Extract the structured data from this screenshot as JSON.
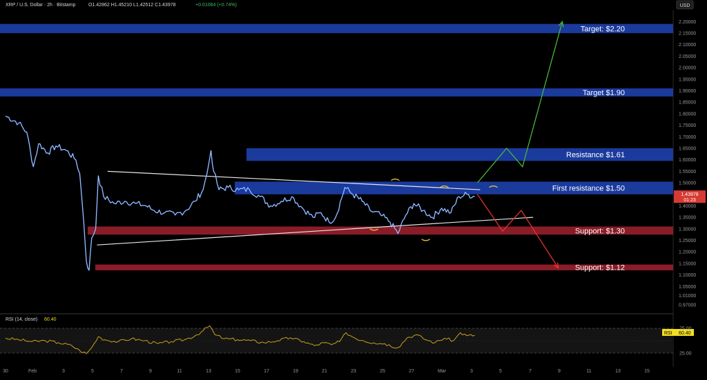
{
  "header": {
    "title": "XRP / U.S. Dollar · 2h · Bitstamp",
    "ohlc_text": "O1.42862 H1.45210 L1.42512 C1.43978",
    "change_text": "+0.01064 (+0.74%)",
    "currency_button": "USD"
  },
  "colors": {
    "background": "#000000",
    "price_line": "#6fa3ff",
    "resistance_zone": "#1a3a9c",
    "support_zone": "#8a1c28",
    "trendline": "#e8e8e8",
    "bull_arrow": "#49b83a",
    "bear_arrow": "#e3332f",
    "rsi_line": "#c8a21e",
    "price_badge": "#d63a32",
    "rsi_badge": "#f2dd22"
  },
  "price_badge": {
    "price": "1.43978",
    "countdown": "01:23"
  },
  "rsi": {
    "title": "RSI (14, close)",
    "value": "60.40",
    "badge_label": "RSI",
    "badge_value": "60.40",
    "upper": 75,
    "lower": 25,
    "upper_label": "75.00",
    "lower_label": "25.00"
  },
  "chart_data": {
    "type": "line",
    "title": "",
    "xlabel": "",
    "ylabel": "",
    "ylim": [
      0.94,
      2.24
    ],
    "y_ticks": [
      "2.20000",
      "2.15000",
      "2.10000",
      "2.05000",
      "2.00000",
      "1.95000",
      "1.90000",
      "1.85000",
      "1.80000",
      "1.75000",
      "1.70000",
      "1.65000",
      "1.60000",
      "1.55000",
      "1.50000",
      "1.45000",
      "1.40000",
      "1.35000",
      "1.30000",
      "1.25000",
      "1.20000",
      "1.15000",
      "1.10000",
      "1.05000",
      "1.01000",
      "0.97000"
    ],
    "x_ticks": [
      "30",
      "Feb",
      "3",
      "5",
      "7",
      "9",
      "11",
      "13",
      "15",
      "17",
      "19",
      "21",
      "23",
      "25",
      "27",
      "Mar",
      "3",
      "5",
      "7",
      "9",
      "11",
      "13",
      "15"
    ],
    "zones": [
      {
        "name": "Target: $2.20",
        "kind": "resistance",
        "low": 2.15,
        "high": 2.19
      },
      {
        "name": "Target $1.90",
        "kind": "resistance",
        "low": 1.875,
        "high": 1.91
      },
      {
        "name": "Resistance $1.61",
        "kind": "resistance",
        "low": 1.595,
        "high": 1.65
      },
      {
        "name": "First resistance $1.50",
        "kind": "resistance",
        "low": 1.45,
        "high": 1.505
      },
      {
        "name": "Support: $1.30",
        "kind": "support",
        "low": 1.275,
        "high": 1.31
      },
      {
        "name": "Support: $1.12",
        "kind": "support",
        "low": 1.12,
        "high": 1.145
      }
    ],
    "series": [
      {
        "values": [
          [
            0.0,
            1.79
          ],
          [
            1.0,
            1.76
          ],
          [
            1.6,
            1.72
          ],
          [
            2.1,
            1.57
          ],
          [
            2.5,
            1.67
          ],
          [
            3.2,
            1.63
          ],
          [
            3.8,
            1.66
          ],
          [
            4.6,
            1.64
          ],
          [
            5.3,
            1.6
          ],
          [
            5.6,
            1.54
          ],
          [
            5.9,
            1.33
          ],
          [
            6.1,
            1.16
          ],
          [
            6.3,
            1.12
          ],
          [
            6.5,
            1.26
          ],
          [
            6.8,
            1.3
          ],
          [
            7.0,
            1.53
          ],
          [
            7.4,
            1.44
          ],
          [
            8.2,
            1.41
          ],
          [
            9.0,
            1.42
          ],
          [
            9.8,
            1.41
          ],
          [
            10.6,
            1.4
          ],
          [
            11.2,
            1.38
          ],
          [
            12.0,
            1.37
          ],
          [
            12.8,
            1.36
          ],
          [
            13.6,
            1.38
          ],
          [
            14.3,
            1.42
          ],
          [
            14.9,
            1.47
          ],
          [
            15.2,
            1.54
          ],
          [
            15.5,
            1.64
          ],
          [
            15.7,
            1.55
          ],
          [
            16.1,
            1.47
          ],
          [
            16.8,
            1.48
          ],
          [
            17.6,
            1.47
          ],
          [
            18.4,
            1.47
          ],
          [
            19.2,
            1.44
          ],
          [
            20.0,
            1.4
          ],
          [
            20.8,
            1.42
          ],
          [
            21.6,
            1.44
          ],
          [
            22.4,
            1.39
          ],
          [
            23.2,
            1.35
          ],
          [
            23.8,
            1.37
          ],
          [
            24.4,
            1.33
          ],
          [
            24.9,
            1.35
          ],
          [
            25.6,
            1.48
          ],
          [
            26.2,
            1.45
          ],
          [
            26.9,
            1.42
          ],
          [
            27.5,
            1.38
          ],
          [
            28.3,
            1.36
          ],
          [
            29.0,
            1.33
          ],
          [
            29.6,
            1.28
          ],
          [
            30.2,
            1.36
          ],
          [
            30.8,
            1.41
          ],
          [
            31.5,
            1.38
          ],
          [
            32.2,
            1.35
          ],
          [
            32.9,
            1.39
          ],
          [
            33.6,
            1.37
          ],
          [
            34.2,
            1.44
          ],
          [
            34.8,
            1.45
          ],
          [
            35.4,
            1.44
          ]
        ]
      }
    ],
    "annotations": [
      "Target: $2.20",
      "Target $1.90",
      "Resistance $1.61",
      "First resistance $1.50",
      "Support: $1.30",
      "Support: $1.12"
    ],
    "rsi_series": [
      [
        0.0,
        55
      ],
      [
        1.0,
        52
      ],
      [
        2.0,
        48
      ],
      [
        3.0,
        50
      ],
      [
        4.0,
        46
      ],
      [
        5.0,
        40
      ],
      [
        5.6,
        30
      ],
      [
        6.1,
        24
      ],
      [
        6.5,
        36
      ],
      [
        7.0,
        58
      ],
      [
        7.5,
        52
      ],
      [
        8.5,
        48
      ],
      [
        9.5,
        54
      ],
      [
        10.5,
        50
      ],
      [
        11.5,
        44
      ],
      [
        12.5,
        48
      ],
      [
        13.5,
        52
      ],
      [
        14.3,
        60
      ],
      [
        14.9,
        70
      ],
      [
        15.4,
        80
      ],
      [
        15.8,
        62
      ],
      [
        16.5,
        54
      ],
      [
        17.5,
        52
      ],
      [
        18.5,
        50
      ],
      [
        19.5,
        46
      ],
      [
        20.5,
        50
      ],
      [
        21.5,
        56
      ],
      [
        22.5,
        48
      ],
      [
        23.3,
        40
      ],
      [
        24.0,
        46
      ],
      [
        24.6,
        42
      ],
      [
        25.2,
        48
      ],
      [
        25.7,
        66
      ],
      [
        26.3,
        56
      ],
      [
        27.0,
        50
      ],
      [
        27.8,
        46
      ],
      [
        28.6,
        44
      ],
      [
        29.6,
        36
      ],
      [
        30.3,
        56
      ],
      [
        31.0,
        62
      ],
      [
        31.7,
        52
      ],
      [
        32.4,
        46
      ],
      [
        33.1,
        55
      ],
      [
        33.8,
        50
      ],
      [
        34.3,
        66
      ],
      [
        34.8,
        60
      ],
      [
        35.4,
        61
      ]
    ]
  },
  "projection": {
    "bull_path": [
      [
        35.6,
        1.5
      ],
      [
        37.8,
        1.65
      ],
      [
        39.0,
        1.57
      ],
      [
        42.0,
        2.2
      ]
    ],
    "bear_path": [
      [
        35.6,
        1.45
      ],
      [
        37.5,
        1.29
      ],
      [
        38.9,
        1.38
      ],
      [
        41.7,
        1.13
      ]
    ]
  }
}
